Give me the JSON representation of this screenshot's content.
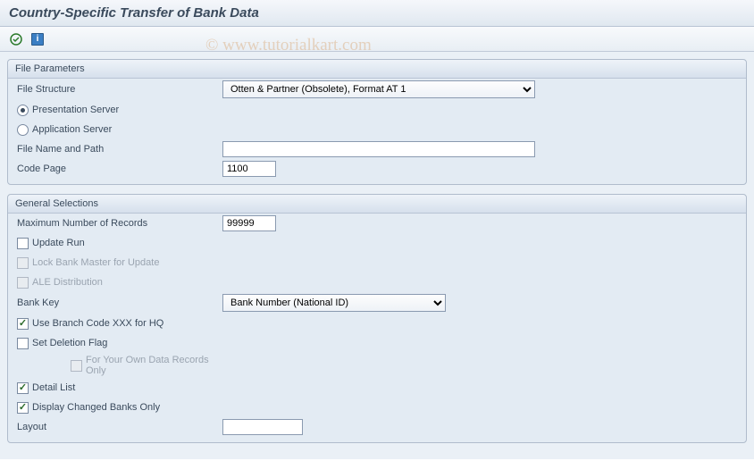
{
  "title": "Country-Specific Transfer of Bank Data",
  "watermark": "© www.tutorialkart.com",
  "info_glyph": "i",
  "groups": {
    "file_params": {
      "header": "File Parameters",
      "file_structure": {
        "label": "File Structure",
        "value": "Otten & Partner (Obsolete), Format AT 1"
      },
      "presentation_server": {
        "label": "Presentation Server"
      },
      "application_server": {
        "label": "Application Server"
      },
      "file_name_path": {
        "label": "File Name and Path",
        "value": ""
      },
      "code_page": {
        "label": "Code Page",
        "value": "1100"
      }
    },
    "general": {
      "header": "General Selections",
      "max_records": {
        "label": "Maximum Number of Records",
        "value": "99999"
      },
      "update_run": {
        "label": "Update Run"
      },
      "lock_bank_master": {
        "label": "Lock Bank Master for Update"
      },
      "ale_distribution": {
        "label": "ALE Distribution"
      },
      "bank_key": {
        "label": "Bank Key",
        "value": "Bank Number (National ID)"
      },
      "use_branch_code": {
        "label": "Use Branch Code XXX for HQ"
      },
      "set_deletion_flag": {
        "label": "Set Deletion Flag"
      },
      "own_data_only": {
        "label": "For Your Own Data Records Only"
      },
      "detail_list": {
        "label": "Detail List"
      },
      "display_changed": {
        "label": "Display Changed Banks Only"
      },
      "layout": {
        "label": "Layout",
        "value": ""
      }
    }
  }
}
